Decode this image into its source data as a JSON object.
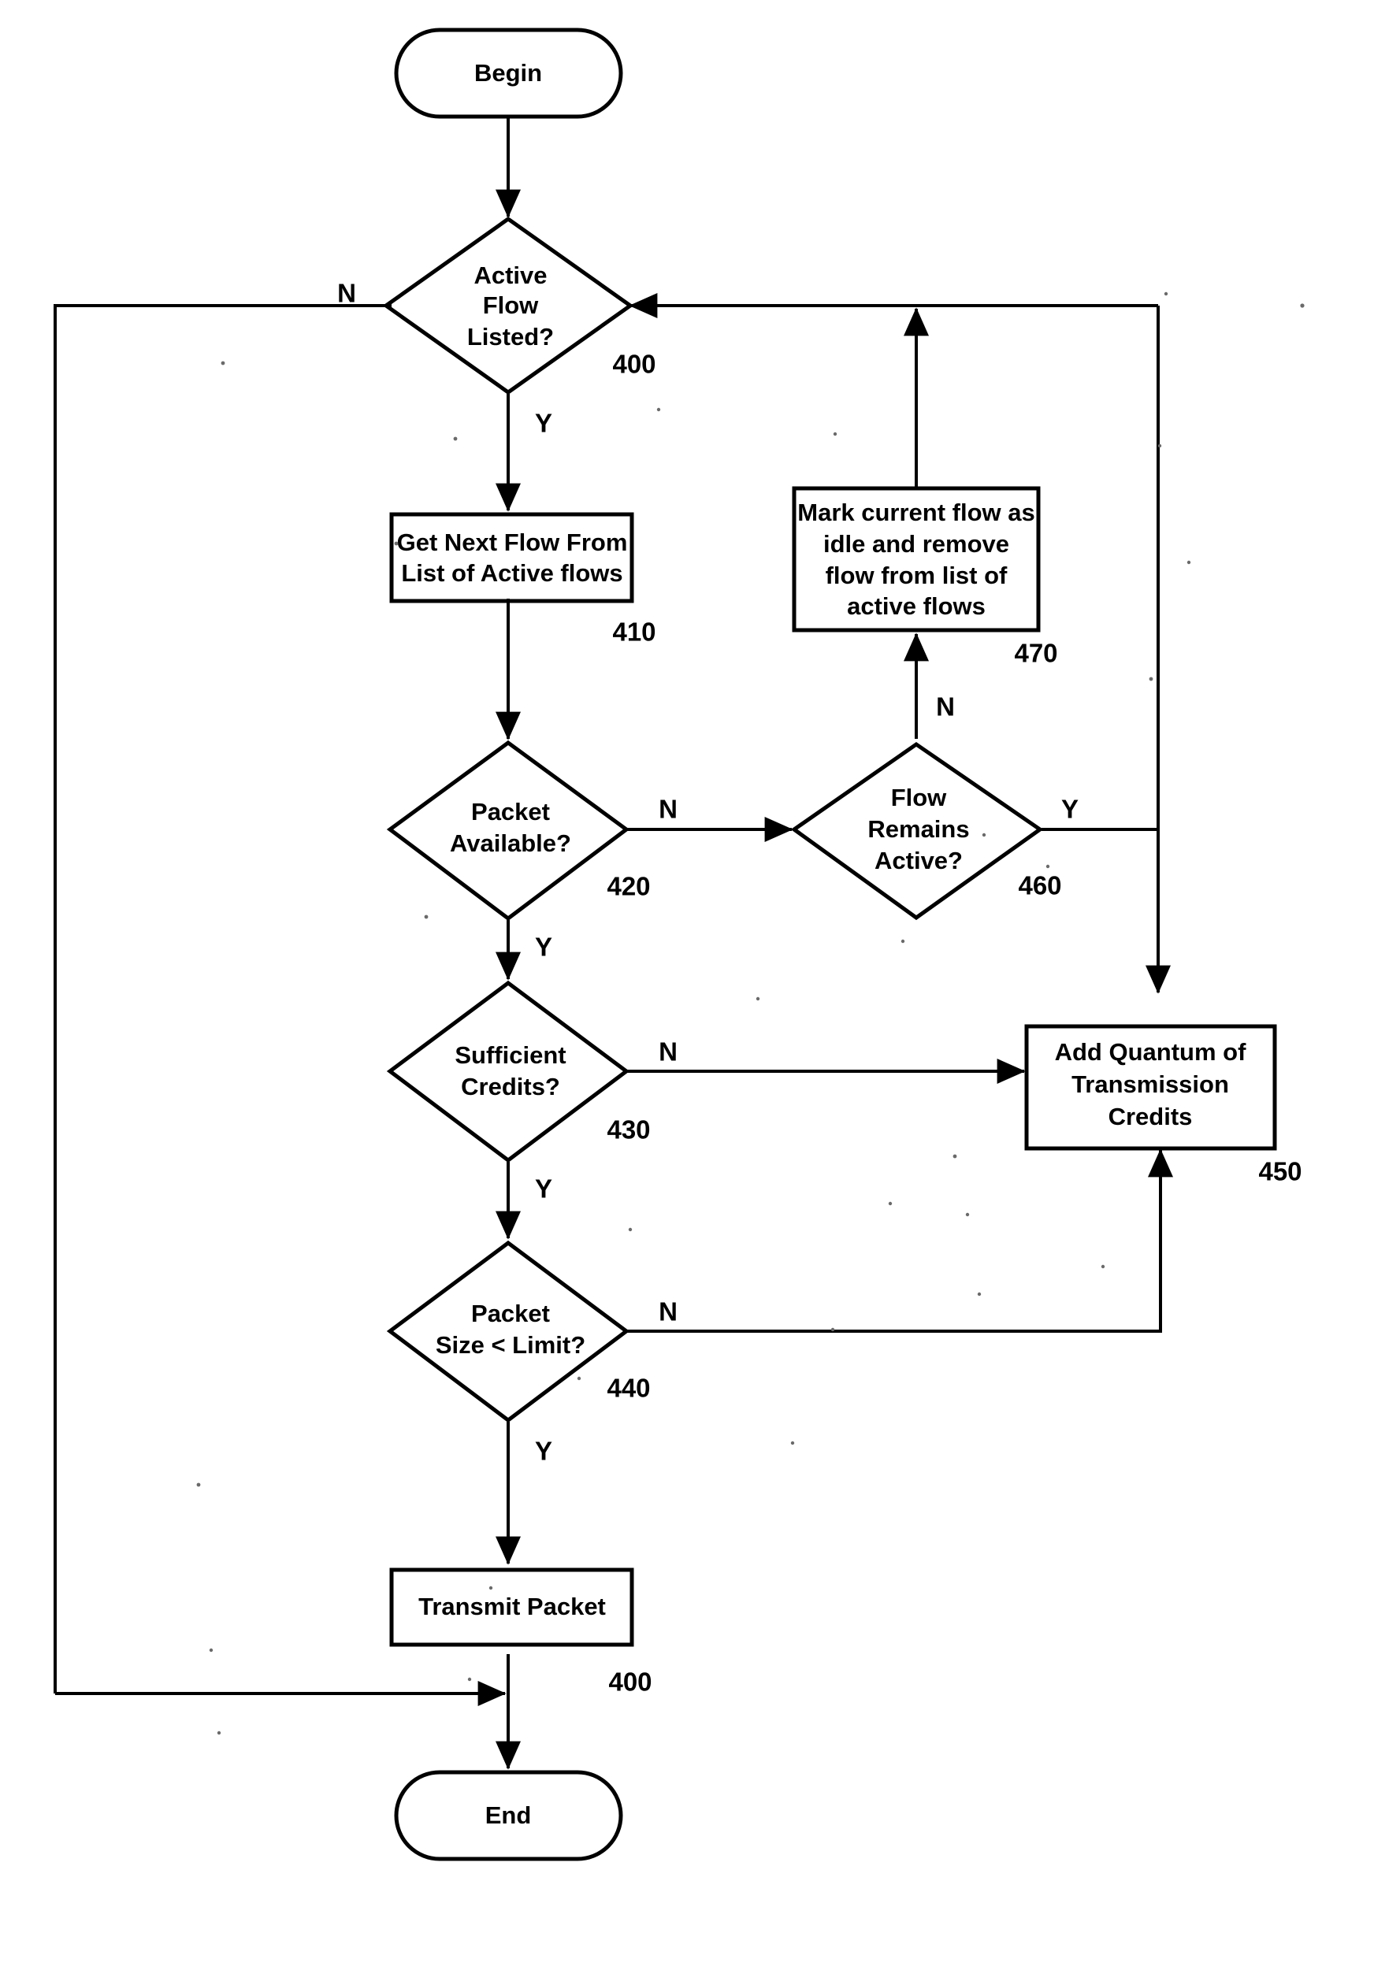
{
  "diagram": {
    "type": "flowchart",
    "title": "",
    "nodes": [
      {
        "id": "begin",
        "shape": "terminator",
        "lines": [
          "Begin"
        ],
        "ref": ""
      },
      {
        "id": "active-flow-listed",
        "shape": "decision",
        "lines": [
          "Active",
          "Flow",
          "Listed?"
        ],
        "ref": "400"
      },
      {
        "id": "get-next-flow",
        "shape": "process",
        "lines": [
          "Get Next Flow From",
          "List of Active flows"
        ],
        "ref": "410"
      },
      {
        "id": "packet-available",
        "shape": "decision",
        "lines": [
          "Packet",
          "Available?"
        ],
        "ref": "420"
      },
      {
        "id": "flow-remains-active",
        "shape": "decision",
        "lines": [
          "Flow",
          "Remains",
          "Active?"
        ],
        "ref": "460"
      },
      {
        "id": "mark-flow-idle",
        "shape": "process",
        "lines": [
          "Mark current flow as",
          "idle and remove",
          "flow from list of",
          "active flows"
        ],
        "ref": "470"
      },
      {
        "id": "sufficient-credits",
        "shape": "decision",
        "lines": [
          "Sufficient",
          "Credits?"
        ],
        "ref": "430"
      },
      {
        "id": "add-quantum-credits",
        "shape": "process",
        "lines": [
          "Add Quantum of",
          "Transmission",
          "Credits"
        ],
        "ref": "450"
      },
      {
        "id": "packet-size-limit",
        "shape": "decision",
        "lines": [
          "Packet",
          "Size < Limit?"
        ],
        "ref": "440"
      },
      {
        "id": "transmit-packet",
        "shape": "process",
        "lines": [
          "Transmit Packet"
        ],
        "ref": "400"
      },
      {
        "id": "end",
        "shape": "terminator",
        "lines": [
          "End"
        ],
        "ref": ""
      }
    ],
    "branch_labels": {
      "active_flow_no": "N",
      "active_flow_yes": "Y",
      "packet_available_no": "N",
      "packet_available_yes": "Y",
      "flow_remains_active_no": "N",
      "flow_remains_active_yes": "Y",
      "sufficient_credits_no": "N",
      "sufficient_credits_yes": "Y",
      "packet_size_no": "N",
      "packet_size_yes": "Y"
    },
    "colors": {
      "stroke": "#000000",
      "fill": "#ffffff",
      "text": "#000000"
    }
  }
}
